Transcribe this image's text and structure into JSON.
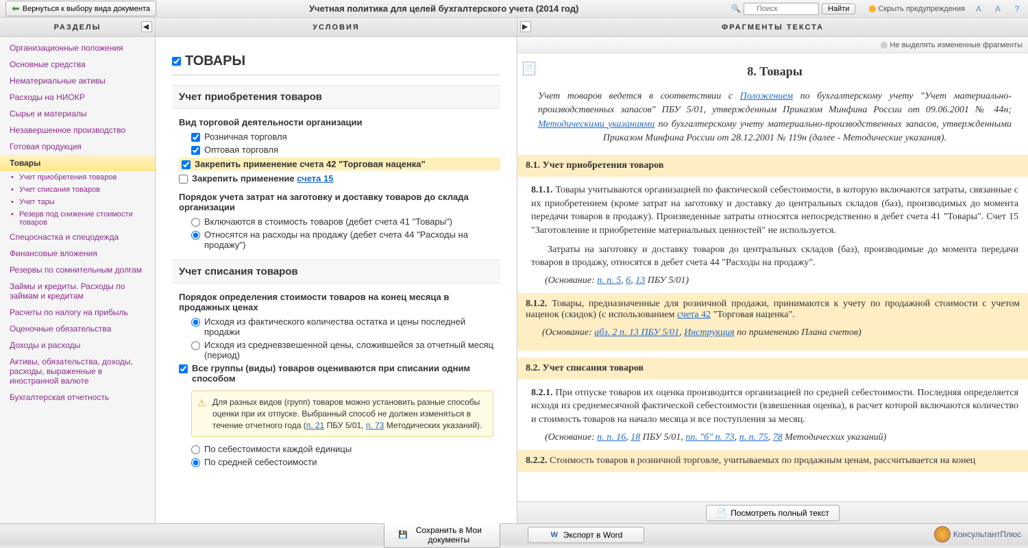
{
  "topbar": {
    "back_label": "Вернуться к выбору вида документа",
    "doc_title": "Учетная политика для целей бухгалтерского учета (2014 год)",
    "search_placeholder": "Поиск",
    "search_btn": "Найти",
    "hide_warn": "Скрыть предупреждения"
  },
  "cols": {
    "left_header": "РАЗДЕЛЫ",
    "mid_header": "УСЛОВИЯ",
    "right_header": "ФРАГМЕНТЫ ТЕКСТА",
    "highlight_toggle": "Не выделять измененные фрагменты"
  },
  "nav": {
    "items": [
      "Организационные положения",
      "Основные средства",
      "Нематериальные активы",
      "Расходы на НИОКР",
      "Сырье и материалы",
      "Незавершенное производство",
      "Готовая продукция"
    ],
    "active": "Товары",
    "sub": [
      "Учет приобретения товаров",
      "Учет списания товаров",
      "Учет тары",
      "Резерв под снижение стоимости товаров"
    ],
    "items2": [
      "Спецоснастка и спецодежда",
      "Финансовые вложения",
      "Резервы по сомнительным долгам",
      "Займы и кредиты. Расходы по займам и кредитам",
      "Расчеты по налогу на прибыль",
      "Оценочные обязательства",
      "Доходы и расходы",
      "Активы, обязательства, доходы, расходы, выраженные в иностранной валюте",
      "Бухгалтерская отчетность"
    ]
  },
  "mid": {
    "title": "ТОВАРЫ",
    "sec1": "Учет приобретения товаров",
    "f1_label": "Вид торговой деятельности организации",
    "f1_opt1": "Розничная торговля",
    "f1_opt2": "Оптовая торговля",
    "f2": "Закрепить применение счета 42 \"Торговая наценка\"",
    "f3_prefix": "Закрепить применение ",
    "f3_link": "счета 15",
    "f4_label": "Порядок учета затрат на заготовку и доставку товаров до склада организации",
    "f4_opt1": "Включаются в стоимость товаров (дебет счета 41 \"Товары\")",
    "f4_opt2": "Относятся на расходы на продажу (дебет счета 44 \"Расходы на продажу\")",
    "sec2": "Учет списания товаров",
    "f5_label": "Порядок определения стоимости товаров на конец месяца в продажных ценах",
    "f5_opt1": "Исходя из фактического количества остатка и цены последней продажи",
    "f5_opt2": "Исходя из средневзвешенной цены, сложившейся за отчетный месяц (период)",
    "f6": "Все группы (виды) товаров оцениваются при списании одним способом",
    "note1_a": "Для разных видов (групп) товаров можно установить разные способы оценки при их отпуске. Выбранный способ не должен изменяться в течение отчетного года (",
    "note1_l1": "п. 21",
    "note1_b": " ПБУ 5/01, ",
    "note1_l2": "п. 73",
    "note1_c": " Методических указаний).",
    "f7_opt1": "По себестоимости каждой единицы",
    "f7_opt2": "По средней себестоимости"
  },
  "right": {
    "h1": "8. Товары",
    "intro_a": "Учет товаров ведется в соответствии с ",
    "intro_l1": "Положением",
    "intro_b": " по бухгалтерскому учету \"Учет материально-производственных запасов\" ПБУ 5/01, утвержденным Приказом Минфина России от 09.06.2001 № 44н; ",
    "intro_l2": "Методическими указаниями",
    "intro_c": " по бухгалтерскому учету материально-производственных запасов, утвержденными Приказом Минфина России от 28.12.2001 № 119н (далее - Методические указания).",
    "s81": "8.1. Учет приобретения товаров",
    "p811_n": "8.1.1.",
    "p811": " Товары учитываются организацией по фактической себестоимости, в которую включаются затраты, связанные с их приобретением (кроме затрат на заготовку и доставку до центральных складов (баз), производимых до момента передачи товаров в продажу). Произведенные затраты относятся непосредственно в дебет счета 41 \"Товары\". Счет 15 \"Заготовление и приобретение материальных ценностей\" не используется.",
    "p811b": "Затраты на заготовку и доставку товаров до центральных складов (баз), производимые до момента передачи товаров в продажу, относятся в дебет счета 44 \"Расходы на продажу\".",
    "cite1_a": "(Основание: ",
    "cite1_l1": "п. п. 5",
    "cite1_s1": ", ",
    "cite1_l2": "6",
    "cite1_s2": ", ",
    "cite1_l3": "13",
    "cite1_b": " ПБУ 5/01)",
    "p812_n": "8.1.2.",
    "p812_a": " Товары, предназначенные для розничной продажи, принимаются к учету по продажной стоимости с учетом наценок (скидок) (с использованием ",
    "p812_l": "счета 42",
    "p812_b": " \"Торговая наценка\".",
    "cite2_a": "(Основание: ",
    "cite2_l1": "абз. 2 п. 13 ПБУ 5/01",
    "cite2_s": ", ",
    "cite2_l2": "Инструкция",
    "cite2_b": " по применению Плана счетов)",
    "s82": "8.2. Учет списания товаров",
    "p821_n": "8.2.1.",
    "p821": " При отпуске товаров их оценка производится организацией по средней себестоимости. Последняя определяется исходя из среднемесячной фактической себестоимости (взвешенная оценка), в расчет которой включаются количество и стоимость товаров на начало месяца и все поступления за месяц.",
    "cite3_a": "(Основание: ",
    "cite3_l1": "п. п. 16",
    "cite3_s1": ", ",
    "cite3_l2": "18",
    "cite3_b1": " ПБУ 5/01, ",
    "cite3_l3": "пп. \"б\" п. 73",
    "cite3_s2": ", ",
    "cite3_l4": "п. п. 75",
    "cite3_s3": ", ",
    "cite3_l5": "78",
    "cite3_b2": " Методических указаний)",
    "p822_n": "8.2.2.",
    "p822": " Стоимость товаров в розничной торговле, учитываемых по продажным ценам, рассчитывается на конец",
    "view_full": "Посмотреть полный текст"
  },
  "bottom": {
    "save": "Сохранить в Мои документы",
    "export": "Экспорт в Word",
    "logo": "КонсультантПлюс"
  }
}
